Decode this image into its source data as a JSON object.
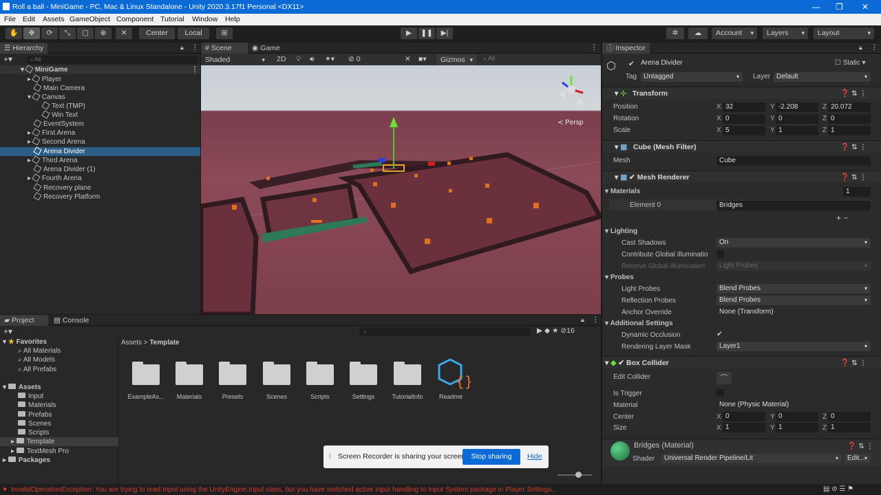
{
  "window": {
    "title": "Roll a ball - MiniGame - PC, Mac & Linux Standalone - Unity 2020.3.17f1 Personal <DX11>"
  },
  "menu": [
    "File",
    "Edit",
    "Assets",
    "GameObject",
    "Component",
    "Tutorial",
    "Window",
    "Help"
  ],
  "toolbar": {
    "center": "Center",
    "local": "Local",
    "account": "Account",
    "layers": "Layers",
    "layout": "Layout"
  },
  "hierarchy": {
    "tab": "Hierarchy",
    "search_placeholder": "All",
    "scene": "MiniGame",
    "items": [
      "Player",
      "Main Camera",
      "Canvas",
      "Text (TMP)",
      "Win Text",
      "EventSystem",
      "First Arena",
      "Second Arena",
      "Arena Divider",
      "Third Arena",
      "Arena Divider (1)",
      "Fourth Arena",
      "Recovery plane",
      "Recovery Platform"
    ]
  },
  "scene": {
    "tab_scene": "Scene",
    "tab_game": "Game",
    "shading": "Shaded",
    "mode": "2D",
    "hidden_count": "0",
    "gizmos": "Gizmos",
    "search": "All",
    "persp": "Persp"
  },
  "inspector": {
    "tab": "Inspector",
    "name": "Arena Divider",
    "static": "Static",
    "tag_label": "Tag",
    "tag": "Untagged",
    "layer_label": "Layer",
    "layer": "Default",
    "transform": {
      "title": "Transform",
      "position_label": "Position",
      "rotation_label": "Rotation",
      "scale_label": "Scale",
      "position": [
        "32",
        "-2.208",
        "20.072"
      ],
      "rotation": [
        "0",
        "0",
        "0"
      ],
      "scale": [
        "5",
        "1",
        "1"
      ]
    },
    "mesh_filter": {
      "title": "Cube (Mesh Filter)",
      "mesh_label": "Mesh",
      "mesh": "Cube"
    },
    "mesh_renderer": {
      "title": "Mesh Renderer",
      "materials_label": "Materials",
      "materials_count": "1",
      "element0_label": "Element 0",
      "element0": "Bridges",
      "lighting": "Lighting",
      "cast_shadows_label": "Cast Shadows",
      "cast_shadows": "On",
      "contribute_gi": "Contribute Global Illuminatio",
      "receive_gi_label": "Receive Global Illumination",
      "receive_gi": "Light Probes",
      "probes": "Probes",
      "light_probes_label": "Light Probes",
      "light_probes": "Blend Probes",
      "reflection_probes_label": "Reflection Probes",
      "reflection_probes": "Blend Probes",
      "anchor_override_label": "Anchor Override",
      "anchor_override": "None (Transform)",
      "additional": "Additional Settings",
      "dynamic_occlusion": "Dynamic Occlusion",
      "rendering_layer_mask_label": "Rendering Layer Mask",
      "rendering_layer_mask": "Layer1"
    },
    "box_collider": {
      "title": "Box Collider",
      "edit_collider": "Edit Collider",
      "is_trigger": "Is Trigger",
      "material_label": "Material",
      "material": "None (Physic Material)",
      "center_label": "Center",
      "center": [
        "0",
        "0",
        "0"
      ],
      "size_label": "Size",
      "size": [
        "1",
        "1",
        "1"
      ]
    },
    "material": {
      "title": "Bridges (Material)",
      "shader_label": "Shader",
      "shader": "Universal Render Pipeline/Lit",
      "edit": "Edit..."
    }
  },
  "project": {
    "tab_project": "Project",
    "tab_console": "Console",
    "favorites": "Favorites",
    "fav_items": [
      "All Materials",
      "All Models",
      "All Prefabs"
    ],
    "assets": "Assets",
    "asset_items": [
      "Input",
      "Materials",
      "Prefabs",
      "Scenes",
      "Scripts",
      "Template",
      "TextMesh Pro"
    ],
    "packages": "Packages",
    "breadcrumb_root": "Assets",
    "breadcrumb_current": "Template",
    "hidden_count": "16",
    "folders": [
      "ExampleAs...",
      "Materials",
      "Presets",
      "Scenes",
      "Scripts",
      "Settings",
      "TutorialInfo"
    ],
    "readme": "Readme"
  },
  "share": {
    "text": "Screen Recorder is sharing your screen.",
    "stop": "Stop sharing",
    "hide": "Hide"
  },
  "status": {
    "error": "InvalidOperationException: You are trying to read Input using the UnityEngine.Input class, but you have switched active Input handling to Input System package in Player Settings."
  },
  "colors": {
    "accent": "#0b6ad6",
    "selection": "#2c5d87",
    "error": "#d23b2e"
  }
}
